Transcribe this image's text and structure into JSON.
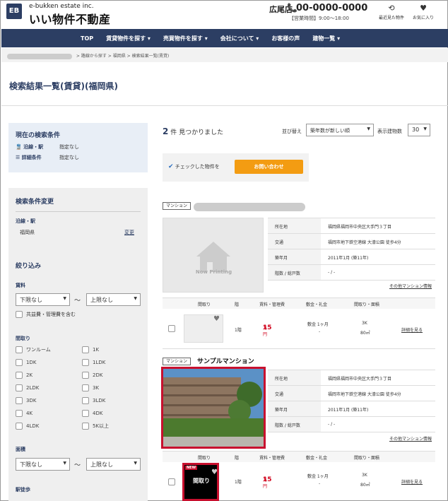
{
  "header": {
    "logo_mark": "EB",
    "logo_sub": "e-bukken estate inc.",
    "logo_main": "いい物件不動産",
    "store": "広尾店",
    "phone": "00-0000-0000",
    "hours": "【営業時間】9:00～18:00",
    "recent": "最近見た物件",
    "favorites": "お気に入り"
  },
  "nav": [
    "TOP",
    "賃貸物件を探す ▾",
    "売買物件を探す ▾",
    "会社について ▾",
    "お客様の声",
    "建物一覧 ▾"
  ],
  "breadcrumb": [
    "> 路線から探す",
    "> 福岡県",
    "> 検索結果一覧(賃貸)"
  ],
  "page_title": "検索結果一覧(賃貸)(福岡県)",
  "current": {
    "title": "現在の検索条件",
    "line_label": "沿線・駅",
    "line_val": "指定なし",
    "detail_label": "詳細条件",
    "detail_val": "指定なし"
  },
  "change": {
    "title": "検索条件変更",
    "line_label": "沿線・駅",
    "pref": "福岡県",
    "change_link": "変更",
    "narrow": "絞り込み",
    "rent": "賃料",
    "rent_min": "下限なし",
    "tilde": "～",
    "rent_max": "上限なし",
    "common": "共益費・管理費を含む",
    "layout_label": "間取り",
    "layouts": [
      "ワンルーム",
      "1K",
      "1DK",
      "1LDK",
      "2K",
      "2DK",
      "2LDK",
      "3K",
      "3DK",
      "3LDK",
      "4K",
      "4DK",
      "4LDK",
      "5K以上"
    ],
    "area": "面積",
    "area_min": "下限なし",
    "area_max": "上限なし",
    "walk": "駅徒歩"
  },
  "results": {
    "count": "2",
    "count_suffix": "件 見つかりました",
    "sort_label": "並び替え",
    "sort_val": "築年数が新しい順",
    "per_label": "表示建物数",
    "per_val": "30",
    "check_text": "チェックした物件を",
    "inquiry": "お問い合わせ"
  },
  "listing1": {
    "tag": "マンション",
    "now": "Now Printing",
    "addr_k": "所在地",
    "addr_v": "福岡県福岡市中央区大手門３丁目",
    "access_k": "交通",
    "access_v": "福岡市地下鉄空港線 大濠公園 徒歩4分",
    "built_k": "築年月",
    "built_v": "2011年1月 (築11年)",
    "floor_k": "階数 / 総戸数",
    "floor_v": "- / -",
    "more": "その他マンション情報"
  },
  "table": {
    "layout": "間取り",
    "floor": "階",
    "rent": "賃料・管理費",
    "deposit": "敷金・礼金",
    "plan": "間取り・面積"
  },
  "unit1": {
    "floor": "1階",
    "price": "15",
    "unit": "万円",
    "deposit": "敷金 1ヶ月",
    "deposit2": "-",
    "plan": "3K",
    "size": "80㎡",
    "detail": "詳細を見る"
  },
  "listing2": {
    "tag": "マンション",
    "name": "サンプルマンション",
    "addr_k": "所在地",
    "addr_v": "福岡県福岡市中央区大手門３丁目",
    "access_k": "交通",
    "access_v": "福岡市地下鉄空港線 大濠公園 徒歩4分",
    "built_k": "築年月",
    "built_v": "2011年1月 (築11年)",
    "floor_k": "階数 / 総戸数",
    "floor_v": "- / -",
    "more": "その他マンション情報"
  },
  "unit2": {
    "new": "NEW",
    "madori": "間取り",
    "floor": "1階",
    "price": "15",
    "unit": "万円",
    "deposit": "敷金 1ヶ月",
    "deposit2": "-",
    "plan": "3K",
    "size": "80㎡",
    "detail": "詳細を見る"
  }
}
